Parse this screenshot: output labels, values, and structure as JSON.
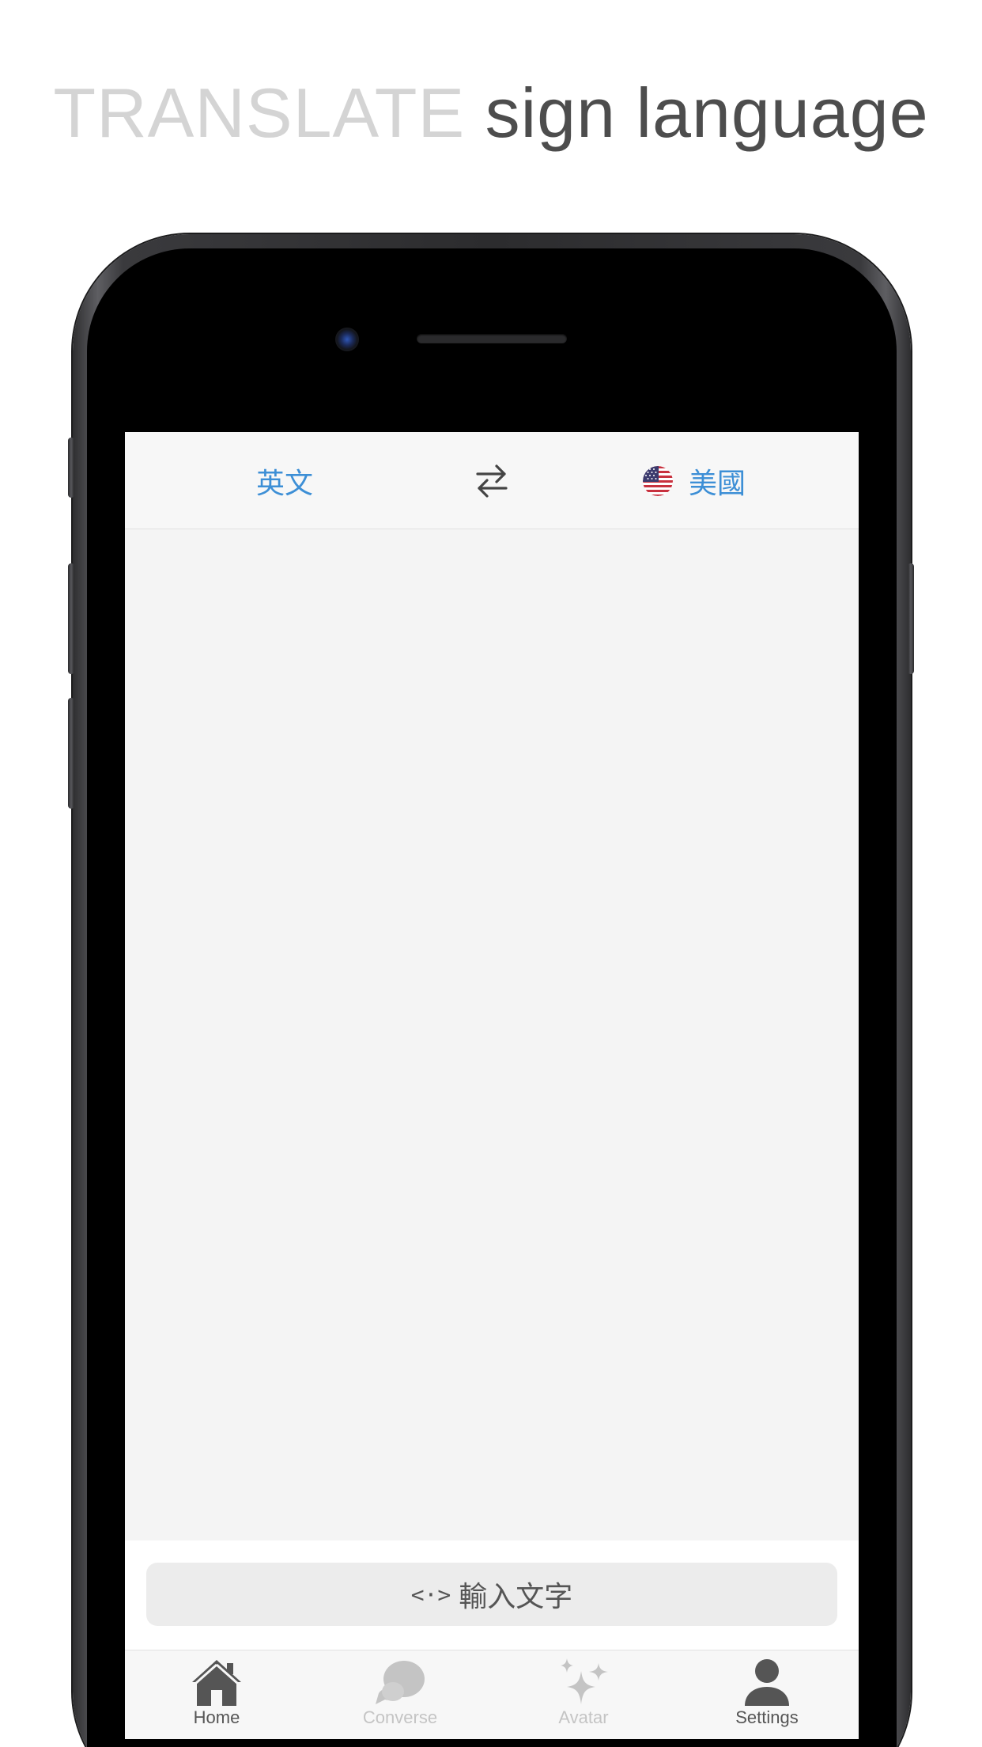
{
  "headline": {
    "accent": "TRANSLATE",
    "main": "sign language"
  },
  "topbar": {
    "source_language": "英文",
    "swap_icon": "swap-arrows-icon",
    "target_flag": "us-flag-icon",
    "target_language": "美國"
  },
  "input": {
    "icon": "<·>",
    "label": "輸入文字"
  },
  "tabs": [
    {
      "label": "Home",
      "icon": "home-icon",
      "active": true
    },
    {
      "label": "Converse",
      "icon": "chat-bubbles-icon",
      "active": false
    },
    {
      "label": "Avatar",
      "icon": "sparkles-icon",
      "active": false
    },
    {
      "label": "Settings",
      "icon": "person-icon",
      "active": true
    }
  ],
  "colors": {
    "accent_blue": "#3d8fd6",
    "headline_light": "#d4d4d4",
    "headline_dark": "#4d4d4d",
    "tab_active": "#555555",
    "tab_inactive": "#c4c4c4"
  }
}
